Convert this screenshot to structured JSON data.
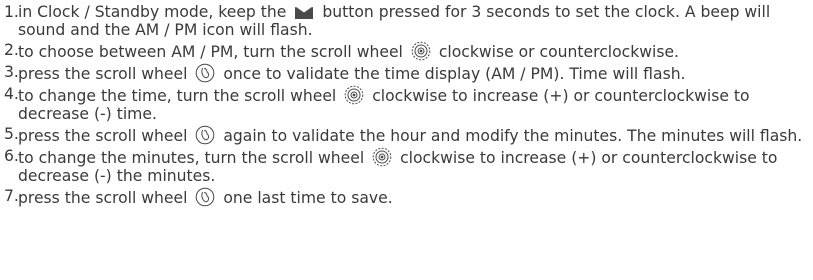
{
  "document": {
    "steps": [
      {
        "num": "1.",
        "before": "in Clock / Standby mode, keep the",
        "icon": "m-button-icon",
        "after": "button pressed for 3 seconds to set the clock. A beep will sound and the AM / PM icon will flash."
      },
      {
        "num": "2.",
        "before": "to choose between AM / PM, turn the scroll wheel",
        "icon": "scroll-wheel-turn-icon",
        "after": "clockwise or counterclockwise."
      },
      {
        "num": "3.",
        "before": "press the scroll wheel",
        "icon": "scroll-wheel-press-icon",
        "after": "once to validate the time display (AM / PM). Time will flash."
      },
      {
        "num": "4.",
        "before": "to change the time, turn the scroll wheel",
        "icon": "scroll-wheel-turn-icon",
        "after": "clockwise to increase (+) or counterclockwise to decrease (-) time."
      },
      {
        "num": "5.",
        "before": "press the scroll wheel",
        "icon": "scroll-wheel-press-icon",
        "after": "again to validate the hour and modify the minutes. The minutes will flash."
      },
      {
        "num": "6.",
        "before": "to change the minutes, turn the scroll wheel",
        "icon": "scroll-wheel-turn-icon",
        "after": "clockwise to increase (+) or counterclockwise to decrease (-) the minutes."
      },
      {
        "num": "7.",
        "before": "press the scroll wheel",
        "icon": "scroll-wheel-press-icon",
        "after": "one last time to save."
      }
    ]
  },
  "colors": {
    "text": "#3a3a3a",
    "icon": "#4a4a4a"
  }
}
